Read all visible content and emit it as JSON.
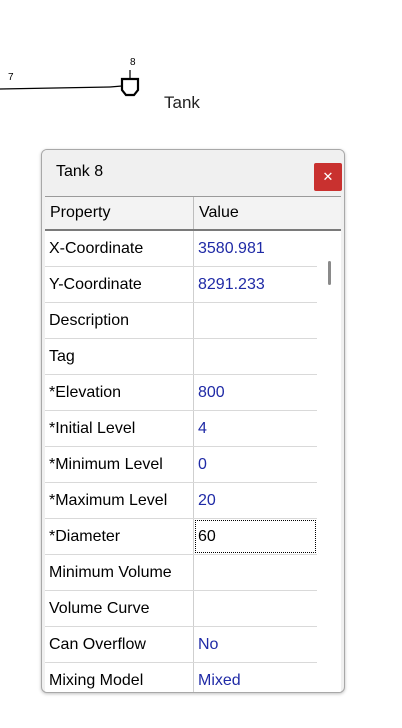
{
  "map": {
    "left_node_id": "7",
    "tank_node_id": "8",
    "tank_label": "Tank",
    "line_color": "#000000"
  },
  "property_window": {
    "title": "Tank 8",
    "close_icon": "close-icon",
    "close_color": "#c9312f",
    "columns": [
      "Property",
      "Value"
    ],
    "rows": [
      {
        "property": "X-Coordinate",
        "value": "3580.981"
      },
      {
        "property": "Y-Coordinate",
        "value": "8291.233"
      },
      {
        "property": "Description",
        "value": ""
      },
      {
        "property": "Tag",
        "value": ""
      },
      {
        "property": "*Elevation",
        "value": "800"
      },
      {
        "property": "*Initial Level",
        "value": "4"
      },
      {
        "property": "*Minimum Level",
        "value": "0"
      },
      {
        "property": "*Maximum Level",
        "value": "20"
      },
      {
        "property": "*Diameter",
        "value": "60",
        "editing": true
      },
      {
        "property": "Minimum Volume",
        "value": ""
      },
      {
        "property": "Volume Curve",
        "value": ""
      },
      {
        "property": "Can Overflow",
        "value": "No"
      },
      {
        "property": "Mixing Model",
        "value": "Mixed"
      }
    ],
    "value_color": "#1f2aa6"
  }
}
